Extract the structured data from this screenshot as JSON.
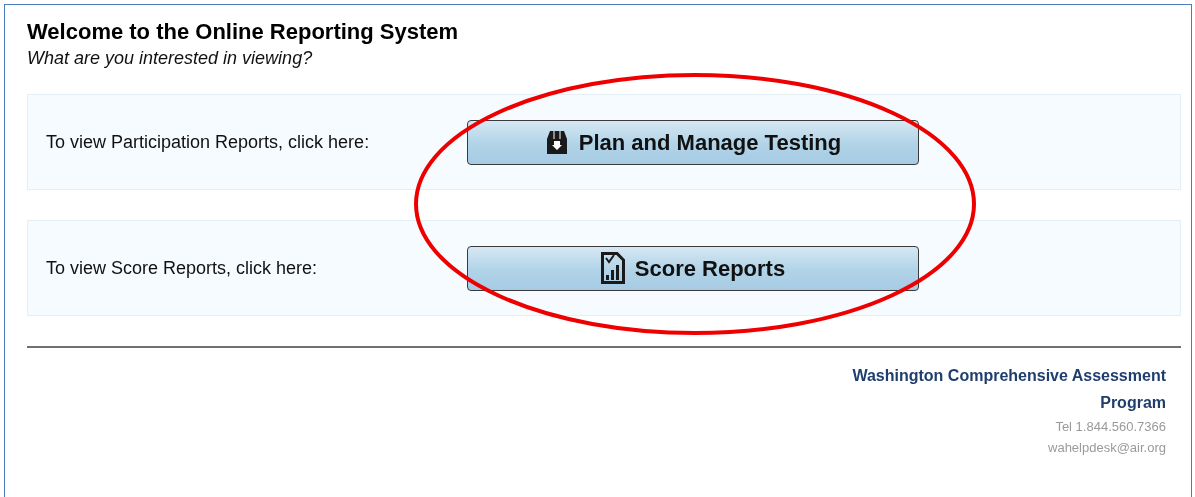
{
  "title": "Welcome to the Online Reporting System",
  "subtitle": "What are you interested in viewing?",
  "options": [
    {
      "label": "To view Participation Reports, click here:",
      "button": "Plan and Manage Testing",
      "kind": "plan"
    },
    {
      "label": "To view Score Reports, click here:",
      "button": "Score Reports",
      "kind": "score"
    }
  ],
  "footer": {
    "organization": "Washington Comprehensive Assessment Program",
    "phone": "Tel 1.844.560.7366",
    "email": "wahelpdesk@air.org"
  }
}
